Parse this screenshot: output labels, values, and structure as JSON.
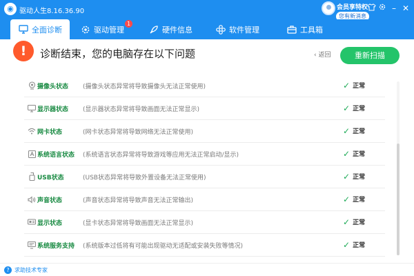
{
  "window": {
    "title": "驱动人生8.16.36.90",
    "vip_label": "会员享特权",
    "login_label": "您有新消息"
  },
  "tabs": [
    {
      "label": "全面诊断",
      "icon": "monitor-icon",
      "active": true
    },
    {
      "label": "驱动管理",
      "icon": "gear-icon",
      "badge": "1"
    },
    {
      "label": "硬件信息",
      "icon": "rocket-icon"
    },
    {
      "label": "软件管理",
      "icon": "apps-icon"
    },
    {
      "label": "工具箱",
      "icon": "toolbox-icon"
    }
  ],
  "header": {
    "title": "诊断结束，您的电脑存在以下问题",
    "back_label": "返回",
    "rescan_label": "重新扫描"
  },
  "items": [
    {
      "name": "摄像头状态",
      "desc": "(摄像头状态异常将导致摄像头无法正常使用)",
      "status": "正常",
      "icon": "camera-icon"
    },
    {
      "name": "显示器状态",
      "desc": "(显示器状态异常将导致画面无法正常显示)",
      "status": "正常",
      "icon": "display-icon"
    },
    {
      "name": "网卡状态",
      "desc": "(网卡状态异常将导致网络无法正常使用)",
      "status": "正常",
      "icon": "wifi-icon"
    },
    {
      "name": "系统语言状态",
      "desc": "(系统语言状态异常将导致游戏等应用无法正常启动/显示)",
      "status": "正常",
      "icon": "language-icon"
    },
    {
      "name": "USB状态",
      "desc": "(USB状态异常将导致外置设备无法正常使用)",
      "status": "正常",
      "icon": "usb-icon"
    },
    {
      "name": "声音状态",
      "desc": "(声音状态异常将导致声音无法正常输出)",
      "status": "正常",
      "icon": "speaker-icon"
    },
    {
      "name": "显示状态",
      "desc": "(显卡状态异常将导致画面无法正常显示)",
      "status": "正常",
      "icon": "graphics-card-icon"
    },
    {
      "name": "系统服务支持",
      "desc": "(系统版本过低将有可能出现驱动无适配或安装失败等情况)",
      "status": "正常",
      "icon": "service-icon"
    }
  ],
  "footer": {
    "support_label": "求助技术专家"
  },
  "colors": {
    "brand": "#1e8ef0",
    "success": "#24c46a",
    "alert": "#ff5a2c",
    "item_name": "#1a8b43"
  }
}
